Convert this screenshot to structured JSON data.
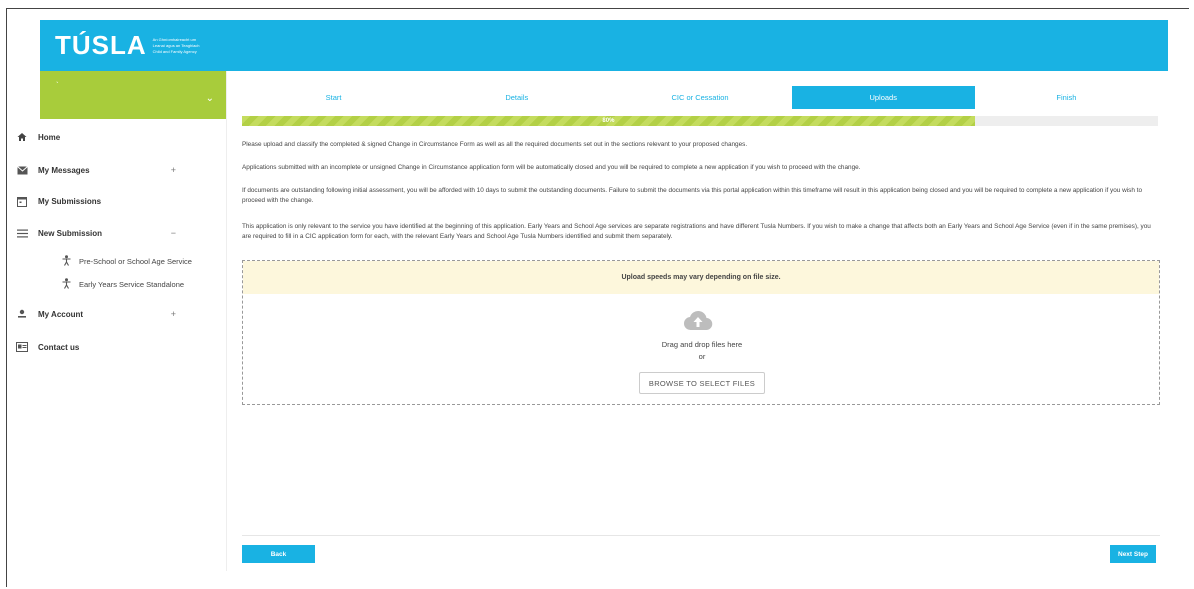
{
  "header": {
    "logo_text": "TÚSLA",
    "logo_sub": [
      "An Ghníomhaireacht um",
      "Leanaí agus an Teaghlach",
      "Child and Family Agency"
    ]
  },
  "sidebar": {
    "items": [
      {
        "label": "Home",
        "icon": "home-icon"
      },
      {
        "label": "My Messages",
        "icon": "envelope-icon",
        "toggle": "+"
      },
      {
        "label": "My Submissions",
        "icon": "calendar-icon"
      },
      {
        "label": "New Submission",
        "icon": "menu-icon",
        "toggle": "−"
      },
      {
        "label": "My Account",
        "icon": "person-icon",
        "toggle": "+"
      },
      {
        "label": "Contact us",
        "icon": "contact-card-icon"
      }
    ],
    "sub_items": [
      {
        "label": "Pre-School or School Age Service",
        "icon": "child-icon"
      },
      {
        "label": "Early Years Service Standalone",
        "icon": "child-icon"
      }
    ]
  },
  "steps": [
    "Start",
    "Details",
    "CIC or Cessation",
    "Uploads",
    "Finish"
  ],
  "active_step": "Uploads",
  "progress": {
    "percent": 80,
    "label": "80%"
  },
  "paragraphs": [
    "Please upload and classify the completed & signed Change in Circumstance Form as well as all the required documents set out in the sections relevant to your proposed changes.",
    "Applications submitted with an incomplete or unsigned Change in Circumstance application form will be automatically closed and you will be required to complete a new application if you wish to proceed with the change.",
    "If documents are outstanding following initial assessment, you will be afforded with 10 days to submit the outstanding documents. Failure to submit the documents via this portal application within this timeframe will result in this application being closed and you will be required to complete a new application if you wish to proceed with the change.",
    "This application is only relevant to the service you have identified at the beginning of this application. Early Years and School Age services are separate registrations and have different Tusla Numbers. If you wish to make a change that affects both an Early Years and School Age Service (even if in the same premises), you are required to fill in a CIC application form for each, with the relevant Early Years and School Age Tusla Numbers identified and submit them separately."
  ],
  "upload": {
    "banner": "Upload speeds may vary depending on file size.",
    "drag_text": "Drag and drop files here",
    "or_text": "or",
    "browse_label": "BROWSE TO SELECT FILES"
  },
  "buttons": {
    "back": "Back",
    "next": "Next Step"
  },
  "colors": {
    "primary": "#19b2e3",
    "green": "#a8cc3b",
    "banner": "#fdf7dc"
  }
}
